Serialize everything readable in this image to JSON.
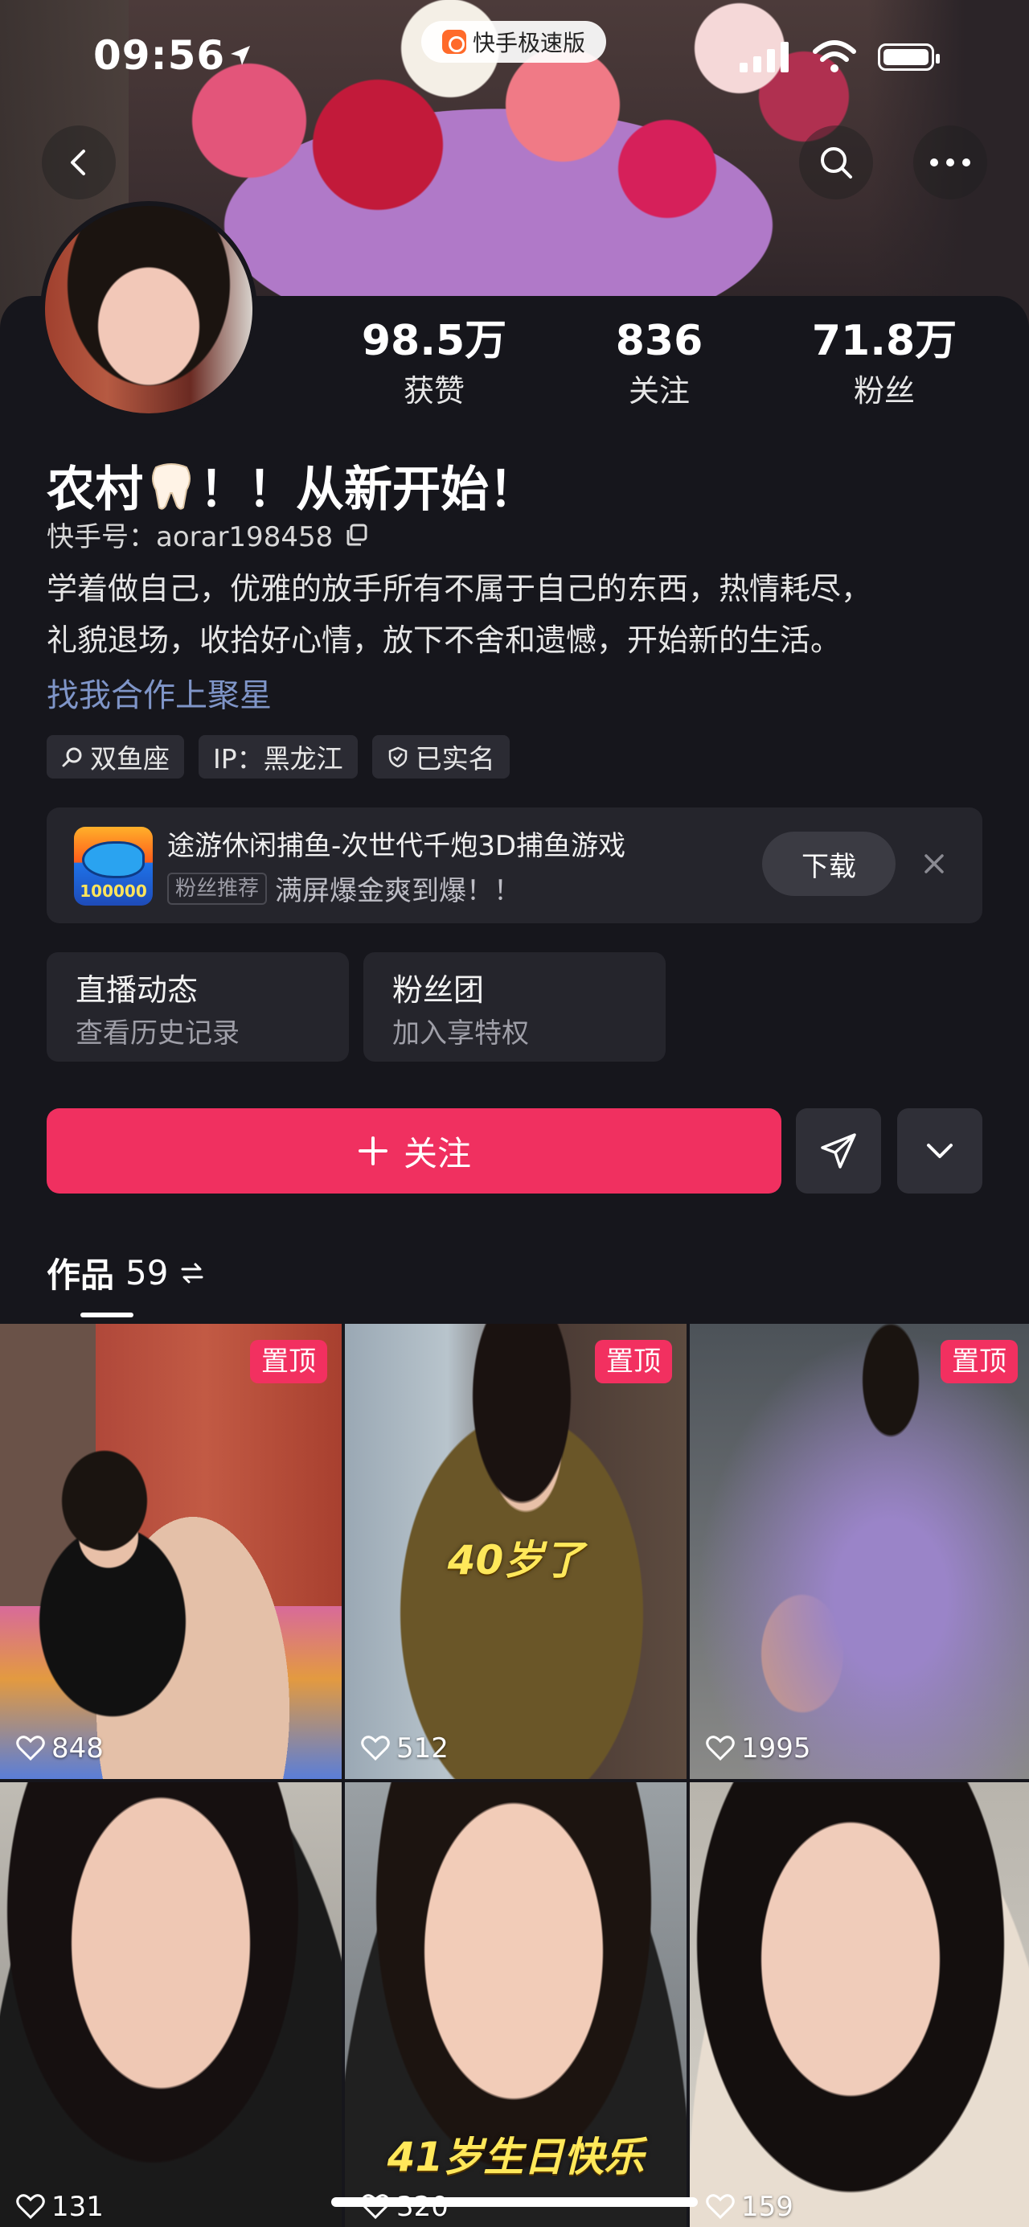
{
  "status_bar": {
    "time": "09:56",
    "app_name": "快手极速版"
  },
  "profile": {
    "stats": [
      {
        "value": "98.5万",
        "label": "获赞"
      },
      {
        "value": "836",
        "label": "关注"
      },
      {
        "value": "71.8万",
        "label": "粉丝"
      }
    ],
    "name": "农村",
    "name_suffix": "！！从新开始！",
    "kid_label": "快手号：",
    "kid_value": "aorar198458",
    "bio_line1": "学着做自己，优雅的放手所有不属于自己的东西，热情耗尽，",
    "bio_line2": "礼貌退场，收拾好心情，放下不舍和遗憾，开始新的生活。",
    "collab_link": "找我合作上聚星",
    "tags": [
      "双鱼座",
      "IP：黑龙江",
      "已实名"
    ]
  },
  "ad": {
    "title": "途游休闲捕鱼-次世代千炮3D捕鱼游戏",
    "badge": "粉丝推荐",
    "desc": "满屏爆金爽到爆！！",
    "download_label": "下载",
    "image_text": "100000"
  },
  "features": [
    {
      "title": "直播动态",
      "sub": "查看历史记录"
    },
    {
      "title": "粉丝团",
      "sub": "加入享特权"
    }
  ],
  "actions": {
    "follow_label": "关注"
  },
  "works": {
    "label": "作品",
    "count": "59",
    "items": [
      {
        "likes": "848",
        "pinned": "置顶",
        "caption": ""
      },
      {
        "likes": "512",
        "pinned": "置顶",
        "caption": "40岁了"
      },
      {
        "likes": "1995",
        "pinned": "置顶",
        "caption": ""
      },
      {
        "likes": "131",
        "pinned": "",
        "caption": ""
      },
      {
        "likes": "320",
        "pinned": "",
        "caption": "41岁生日快乐"
      },
      {
        "likes": "159",
        "pinned": "",
        "caption": ""
      }
    ]
  },
  "colors": {
    "accent": "#f03060",
    "background": "#16161c",
    "link": "#7f95c8"
  }
}
